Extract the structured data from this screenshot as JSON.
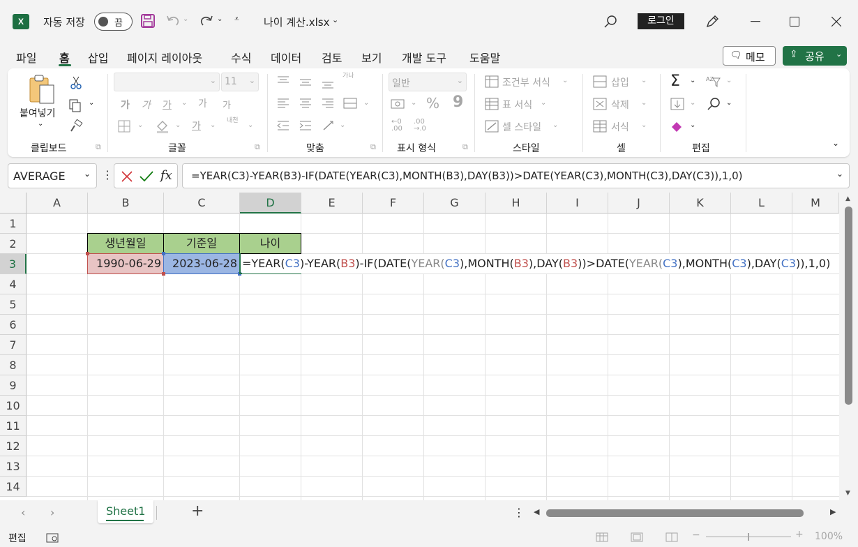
{
  "title_bar": {
    "autosave_label": "자동 저장",
    "autosave_state": "끔",
    "filename": "나이 계산.xlsx",
    "login": "로그인"
  },
  "menu": [
    "파일",
    "홈",
    "삽입",
    "페이지 레이아웃",
    "수식",
    "데이터",
    "검토",
    "보기",
    "개발 도구",
    "도움말"
  ],
  "menu_buttons": {
    "memo": "메모",
    "share": "공유"
  },
  "ribbon": {
    "clipboard": {
      "paste": "붙여넣기",
      "label": "클립보드"
    },
    "font": {
      "size": "11",
      "bold": "가",
      "italic": "가",
      "underline": "가",
      "grow": "가",
      "shrink": "가",
      "phonetic": "내천",
      "color": "가",
      "label": "글꼴"
    },
    "align": {
      "wrap": "가나",
      "label": "맞춤"
    },
    "number": {
      "format": "일반",
      "label": "표시 형식"
    },
    "styles": {
      "conditional": "조건부 서식",
      "table": "표 서식",
      "cell": "셀 스타일",
      "label": "스타일"
    },
    "cells": {
      "insert": "삽입",
      "delete": "삭제",
      "format": "서식",
      "label": "셀"
    },
    "editing": {
      "label": "편집"
    }
  },
  "formula_bar": {
    "name_box": "AVERAGE",
    "fx": "fx",
    "formula": "=YEAR(C3)-YEAR(B3)-IF(DATE(YEAR(C3),MONTH(B3),DAY(B3))>DATE(YEAR(C3),MONTH(C3),DAY(C3)),1,0)"
  },
  "columns": [
    "A",
    "B",
    "C",
    "D",
    "E",
    "F",
    "G",
    "H",
    "I",
    "J",
    "K",
    "L",
    "M"
  ],
  "rows": [
    "1",
    "2",
    "3",
    "4",
    "5",
    "6",
    "7",
    "8",
    "9",
    "10",
    "11",
    "12",
    "13",
    "14"
  ],
  "cells": {
    "B2": "생년월일",
    "C2": "기준일",
    "D2": "나이",
    "B3": "1990-06-29",
    "C3": "2023-06-28"
  },
  "cell_formula": {
    "p1": "=YEAR(",
    "c3a": "C3",
    "p2": ")-YEAR(",
    "b3a": "B3",
    "p3": ")-IF(DATE(",
    "y1": "YEAR(",
    "c3b": "C3",
    "p4": "),MONTH(",
    "b3b": "B3",
    "p5": "),DAY(",
    "b3c": "B3",
    "p6": "))>DATE(",
    "y2": "YEAR(",
    "c3c": "C3",
    "p7": "),MONTH(",
    "c3d": "C3",
    "p8": "),DAY(",
    "c3e": "C3",
    "p9": ")),1,0)"
  },
  "sheet_tab": "Sheet1",
  "status": {
    "mode": "편집",
    "zoom": "100%"
  },
  "colors": {
    "header_fill": "#a9d08e",
    "b3_fill": "#e8c4c4",
    "c3_fill": "#9bb6e3",
    "ref_red": "#c0504d",
    "ref_blue": "#4472c4",
    "accent": "#217346"
  }
}
